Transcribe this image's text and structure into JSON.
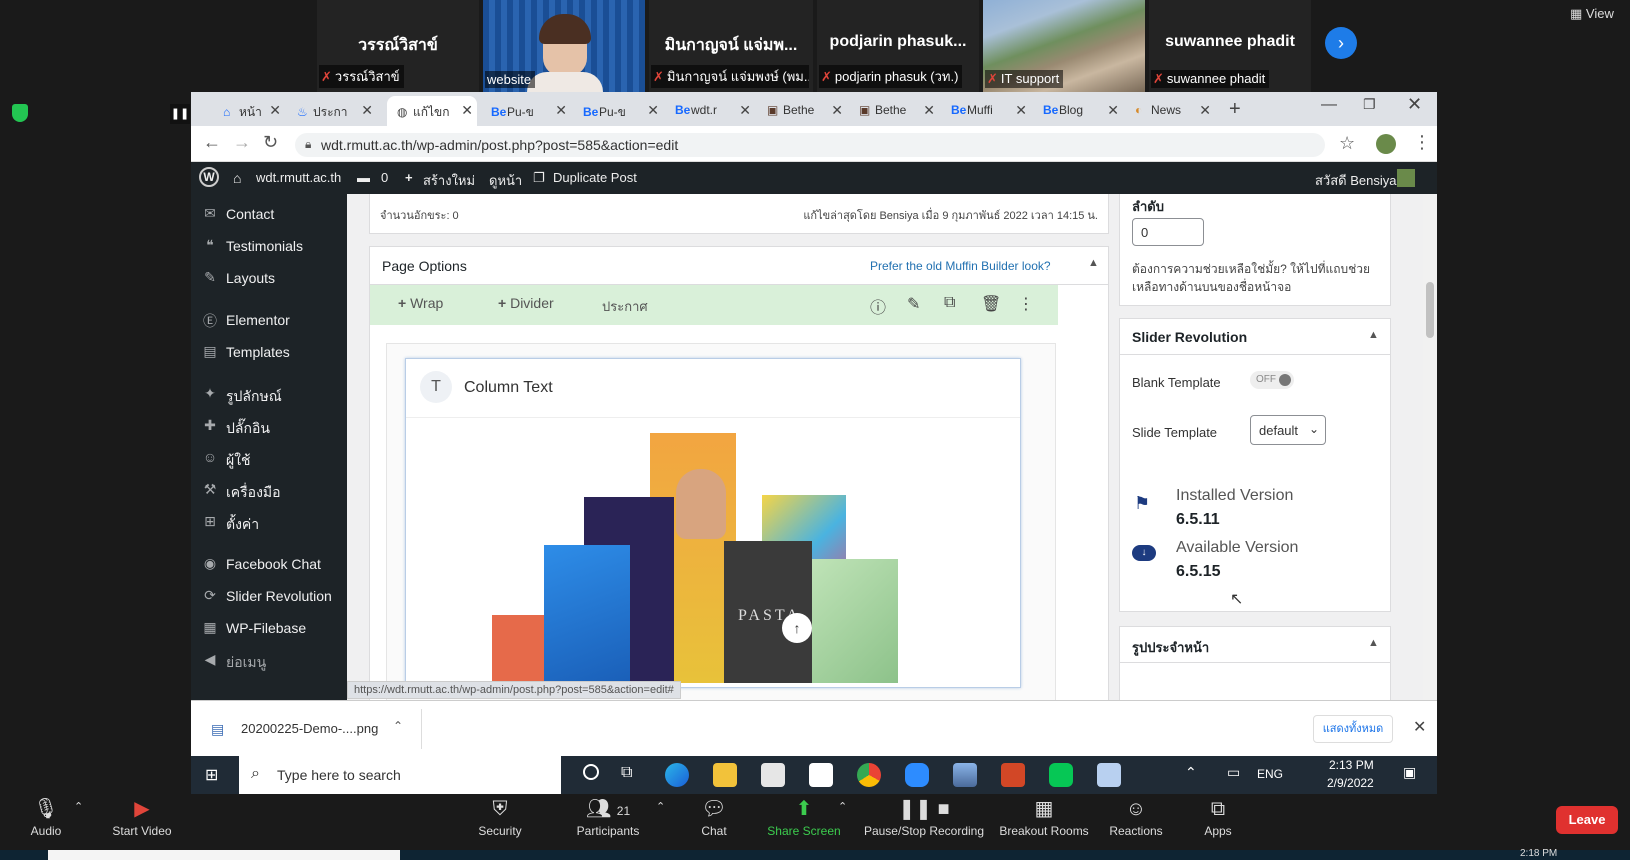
{
  "zoom": {
    "view_label": "View",
    "participants_strip": [
      {
        "name": "วรรณ์วิสาข์",
        "caption": "วรรณ์วิสาข์",
        "muted": true
      },
      {
        "name": "",
        "caption": "website",
        "muted": false,
        "video": true
      },
      {
        "name": "มินกาญจน์ แจ่มพ...",
        "caption": "มินกาญจน์ แจ่มพงษ์ (พม...",
        "muted": true
      },
      {
        "name": "podjarin phasuk...",
        "caption": "podjarin phasuk (วท.)",
        "muted": true
      },
      {
        "name": "",
        "caption": "IT support",
        "muted": true,
        "video": true
      },
      {
        "name": "suwannee phadit",
        "caption": "suwannee phadit",
        "muted": true
      }
    ],
    "controls": {
      "audio": "Audio",
      "start_video": "Start Video",
      "security": "Security",
      "participants": "Participants",
      "participants_count": "21",
      "chat": "Chat",
      "share_screen": "Share Screen",
      "pause_recording": "Pause/Stop Recording",
      "breakout_rooms": "Breakout Rooms",
      "reactions": "Reactions",
      "apps": "Apps",
      "leave": "Leave"
    },
    "bottom_time": "2:18 PM"
  },
  "browser": {
    "tabs": [
      {
        "icon": "⌂",
        "label": "หน้า"
      },
      {
        "icon": "♨",
        "label": "ประกา"
      },
      {
        "icon": "◍",
        "label": "แก้ไขก",
        "active": true
      },
      {
        "icon": "Be",
        "label": "Pu-ข"
      },
      {
        "icon": "Be",
        "label": "Pu-ข"
      },
      {
        "icon": "Be",
        "label": "wdt.r"
      },
      {
        "icon": "▣",
        "label": "Bethe"
      },
      {
        "icon": "▣",
        "label": "Bethe"
      },
      {
        "icon": "Be",
        "label": "Muffi"
      },
      {
        "icon": "Be",
        "label": "Blog"
      },
      {
        "icon": "◐",
        "label": "News"
      }
    ],
    "url": "wdt.rmutt.ac.th/wp-admin/post.php?post=585&action=edit",
    "status_url": "https://wdt.rmutt.ac.th/wp-admin/post.php?post=585&action=edit#"
  },
  "wp": {
    "adminbar": {
      "site": "wdt.rmutt.ac.th",
      "comments": "0",
      "new": "สร้างใหม่",
      "view": "ดูหน้า",
      "duplicate": "Duplicate Post",
      "greeting": "สวัสดี Bensiya"
    },
    "sidebar": [
      {
        "icon": "✉",
        "label": "Contact"
      },
      {
        "icon": "❝",
        "label": "Testimonials"
      },
      {
        "icon": "✎",
        "label": "Layouts"
      },
      {
        "icon": "Ⓔ",
        "label": "Elementor"
      },
      {
        "icon": "▤",
        "label": "Templates"
      },
      {
        "icon": "✦",
        "label": "รูปลักษณ์"
      },
      {
        "icon": "✚",
        "label": "ปลั๊กอิน"
      },
      {
        "icon": "☺",
        "label": "ผู้ใช้"
      },
      {
        "icon": "⚒",
        "label": "เครื่องมือ"
      },
      {
        "icon": "⊞",
        "label": "ตั้งค่า"
      },
      {
        "icon": "◉",
        "label": "Facebook Chat"
      },
      {
        "icon": "⟳",
        "label": "Slider Revolution"
      },
      {
        "icon": "▦",
        "label": "WP-Filebase"
      },
      {
        "icon": "◀",
        "label": "ย่อเมนู"
      }
    ],
    "editor": {
      "word_count": "จำนวนอักขระ: 0",
      "last_edit": "แก้ไขล่าสุดโดย Bensiya เมื่อ 9 กุมภาพันธ์ 2022 เวลา 14:15 น.",
      "page_options": "Page Options",
      "prefer_old": "Prefer the old Muffin Builder look?",
      "wrap": "Wrap",
      "divider": "Divider",
      "section_label": "ประกาศ",
      "column_text": "Column Text"
    },
    "right": {
      "order_label": "ลำดับ",
      "order_value": "0",
      "help_text": "ต้องการความช่วยเหลือใช่มั้ย? ให้ไปที่แถบช่วยเหลือทางด้านบนของชื่อหน้าจอ",
      "slider_title": "Slider Revolution",
      "blank_template": "Blank Template",
      "toggle_state": "OFF",
      "slide_template": "Slide Template",
      "slide_template_value": "default",
      "installed_label": "Installed Version",
      "installed_value": "6.5.11",
      "available_label": "Available Version",
      "available_value": "6.5.15",
      "featured_title": "รูปประจำหน้า"
    }
  },
  "download": {
    "filename": "20200225-Demo-....png",
    "show_all": "แสดงทั้งหมด"
  },
  "taskbar": {
    "search_placeholder": "Type here to search",
    "lang": "ENG",
    "time": "2:13 PM",
    "date": "2/9/2022"
  }
}
